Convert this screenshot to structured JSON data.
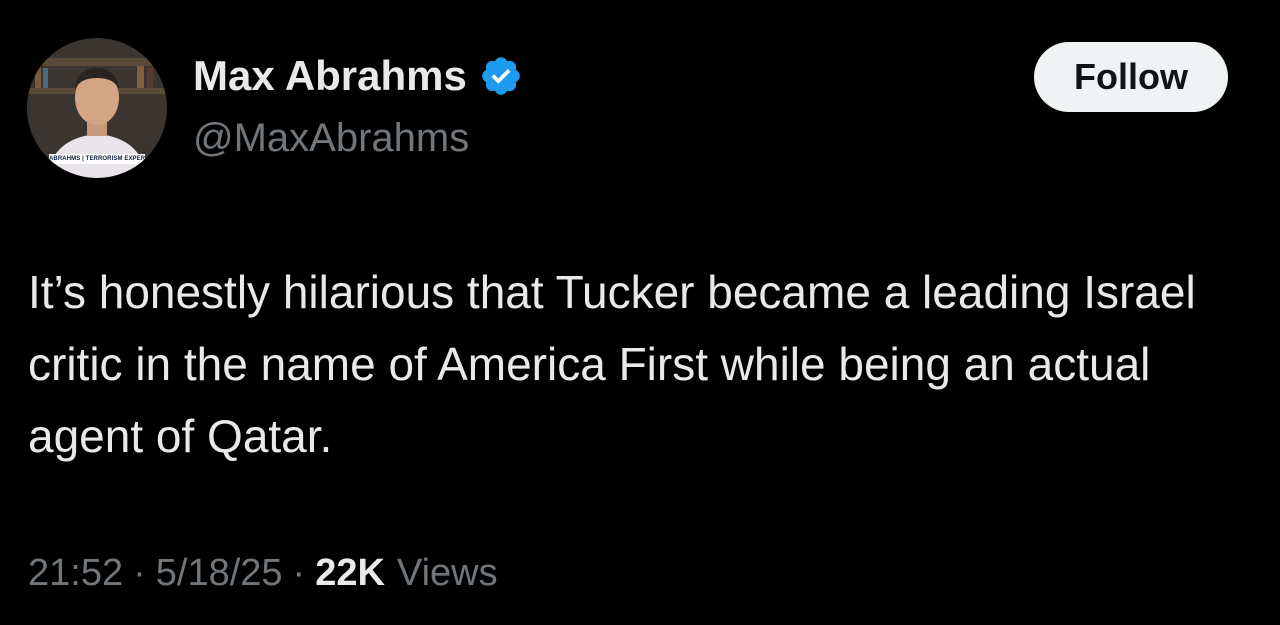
{
  "author": {
    "display_name": "Max Abrahms",
    "handle": "@MaxAbrahms",
    "verified": true,
    "avatar_caption": "ABRAHMS | TERRORISM EXPERT"
  },
  "follow_button": {
    "label": "Follow"
  },
  "tweet": {
    "text": "It’s honestly hilarious that Tucker became a leading Israel critic in the name of America First while being an actual agent of Qatar.",
    "time": "21:52",
    "separator": "·",
    "date": "5/18/25",
    "views_count": "22K",
    "views_label": "Views"
  },
  "colors": {
    "background": "#000000",
    "primary_text": "#e7e9ea",
    "secondary_text": "#71767b",
    "verified_blue": "#1d9bf0",
    "follow_bg": "#eff3f4",
    "follow_text": "#0f1419"
  },
  "icons": {
    "verified": "verified-badge-icon"
  }
}
